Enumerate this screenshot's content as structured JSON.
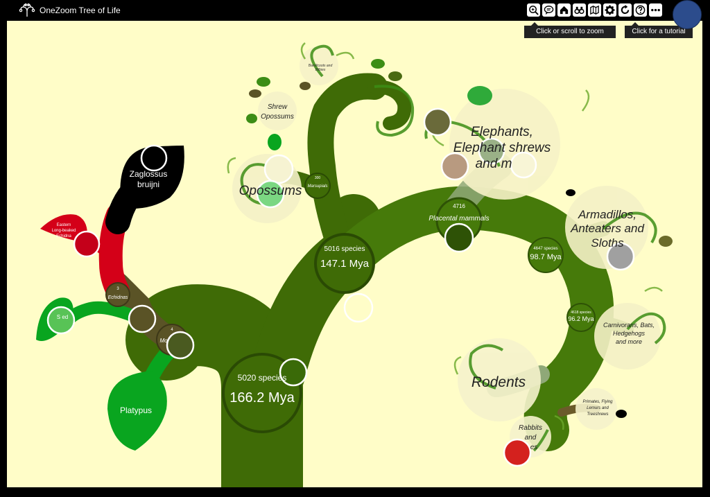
{
  "app": {
    "title": "OneZoom Tree of Life"
  },
  "toolbar": {
    "buttons": [
      {
        "name": "zoom-icon",
        "label": "zoom"
      },
      {
        "name": "chat-icon",
        "label": "comments"
      },
      {
        "name": "home-icon",
        "label": "home"
      },
      {
        "name": "binoculars-icon",
        "label": "search"
      },
      {
        "name": "map-icon",
        "label": "location"
      },
      {
        "name": "gear-icon",
        "label": "settings"
      },
      {
        "name": "refresh-icon",
        "label": "reset"
      },
      {
        "name": "help-icon",
        "label": "help"
      },
      {
        "name": "more-icon",
        "label": "more"
      }
    ],
    "tooltips": {
      "zoom": "Click or scroll to zoom",
      "tutorial": "Click for a tutorial"
    }
  },
  "colors": {
    "background": "#fffdc8",
    "trunk": "#3f6b06",
    "placental": "#467a0a",
    "monotreme": "#5a5326",
    "echidna_red": "#d40018",
    "zaglossus": "#000000",
    "platypus": "#09a51f"
  },
  "tree": {
    "root": {
      "species": "5020 species",
      "mya": "166.2 Mya"
    },
    "marsupial_node": {
      "species": "5016 species",
      "mya": "147.1 Mya"
    },
    "placental_node": {
      "species": "4716",
      "label": "Placental mammals"
    },
    "node_4647": {
      "species": "4647 species",
      "mya": "98.7 Mya"
    },
    "node_4618": {
      "species": "4618 species",
      "mya": "96.2 Mya"
    },
    "marsupials": {
      "count": "300",
      "label": "Marsupials"
    },
    "echidnas": {
      "count": "3",
      "label": "Echidnas"
    },
    "monotremes": {
      "count": "4",
      "label": "Mo"
    },
    "leaves": {
      "zaglossus": [
        "Zaglossus",
        "bruijni"
      ],
      "eastern_echidna": [
        "Eastern",
        "Long-beaked",
        "Echidna"
      ],
      "short_beaked": "S         ed",
      "platypus": "Platypus"
    },
    "clades": {
      "bandicoots": [
        "Bandicoots and",
        "Bilbies"
      ],
      "shrew_opossums": [
        "Shrew",
        "Opossums"
      ],
      "opossums": "Opossums",
      "elephants": [
        "Elephants,",
        "Elephant shrews",
        "and m"
      ],
      "armadillos": [
        "Armadillos,",
        "Anteaters and",
        "Sloths"
      ],
      "carnivorans": [
        "Carnivorans, Bats,",
        "Hedgehogs",
        "and more"
      ],
      "rodents": "Rodents",
      "rabbits": [
        "Rabbits",
        "and",
        "es"
      ],
      "primates": [
        "Primates, Flying",
        "Lemurs and",
        "Treeshrews"
      ]
    }
  }
}
